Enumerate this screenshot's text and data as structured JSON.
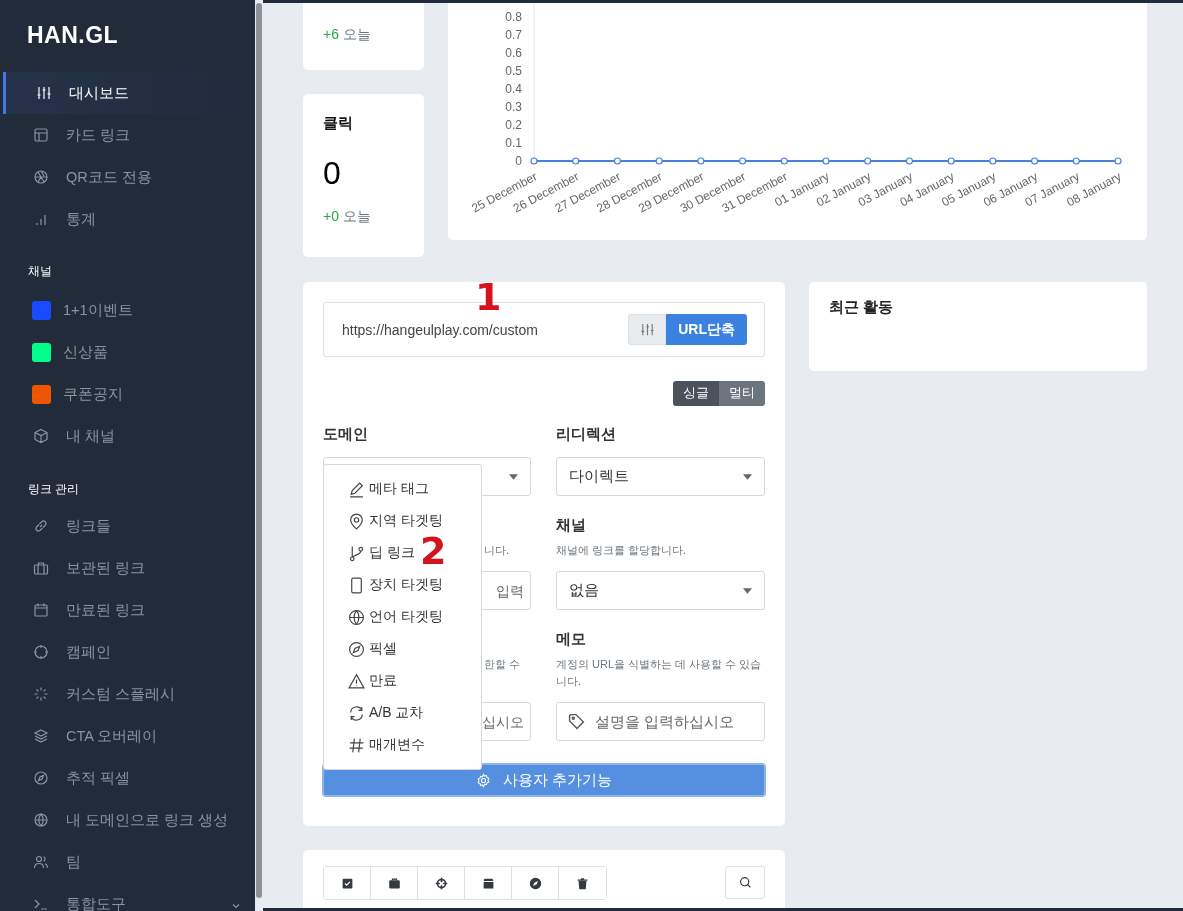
{
  "sidebar": {
    "logo": "HAN.GL",
    "nav": [
      {
        "label": "대시보드",
        "selected": true
      },
      {
        "label": "카드 링크",
        "selected": false
      },
      {
        "label": "QR코드 전용",
        "selected": false
      },
      {
        "label": "통계",
        "selected": false
      }
    ],
    "channels": {
      "heading": "채널",
      "items": [
        {
          "label": "1+1이벤트",
          "kind": "color",
          "color": "#1a4cff",
          "selected": false
        },
        {
          "label": "신상품",
          "kind": "color",
          "color": "#00ff88",
          "selected": false
        },
        {
          "label": "쿠폰공지",
          "kind": "color",
          "color": "#ee5500",
          "selected": false
        },
        {
          "label": "내 채널",
          "kind": "icon",
          "selected": false
        }
      ]
    },
    "links": {
      "heading": "링크 관리",
      "items": [
        {
          "label": "링크들",
          "kind": "link",
          "selected": false
        },
        {
          "label": "보관된 링크",
          "kind": "link",
          "selected": false
        },
        {
          "label": "만료된 링크",
          "kind": "link",
          "selected": false
        },
        {
          "label": "캠페인",
          "kind": "link",
          "selected": false
        },
        {
          "label": "커스텀 스플레시",
          "kind": "link",
          "selected": false
        },
        {
          "label": "CTA 오버레이",
          "kind": "link",
          "selected": false
        },
        {
          "label": "추적 픽셀",
          "kind": "link",
          "selected": false
        },
        {
          "label": "내 도메인으로 링크 생성",
          "kind": "link",
          "selected": false
        },
        {
          "label": "팀",
          "kind": "link",
          "selected": false
        },
        {
          "label": "통합도구",
          "kind": "group",
          "selected": false
        }
      ]
    }
  },
  "stats": [
    {
      "delta": "+6",
      "delta_label": "오늘"
    },
    {
      "title": "클릭",
      "value": "0",
      "delta": "+0",
      "delta_label": "오늘"
    }
  ],
  "chart": {
    "chart_data": {
      "type": "line",
      "categories": [
        "25 December",
        "26 December",
        "27 December",
        "28 December",
        "29 December",
        "30 December",
        "31 December",
        "01 January",
        "02 January",
        "03 January",
        "04 January",
        "05 January",
        "06 January",
        "07 January",
        "08 January"
      ],
      "series": [
        {
          "color": "#4a80dc",
          "marker": true,
          "values": [
            0,
            0,
            0,
            0,
            0,
            0,
            0,
            0,
            0,
            0,
            0,
            0,
            0,
            0,
            0
          ]
        }
      ],
      "ylim": [
        0,
        0.9
      ],
      "yticks": [
        0,
        0.1,
        0.2,
        0.3,
        0.4,
        0.5,
        0.6,
        0.7,
        0.8
      ]
    }
  },
  "form": {
    "url_value": "https://hangeulplay.com/custom",
    "shorten_button": "URL단축",
    "mode_toggle": [
      {
        "label": "싱글",
        "selected": true
      },
      {
        "label": "멀티",
        "selected": false
      }
    ],
    "fields": [
      {
        "kind": "select",
        "label": "도메인"
      },
      {
        "kind": "select",
        "label": "리디렉션",
        "value": "다이렉트"
      },
      {
        "kind": "input",
        "description": "니다.",
        "placeholder": "입력",
        "covered": true
      },
      {
        "kind": "select",
        "label": "채널",
        "description": "채널에 링크를 할당합니다.",
        "value": "없음"
      },
      {
        "kind": "input",
        "description": "한할 수",
        "placeholder": "십시오",
        "covered": true
      },
      {
        "kind": "tag-input",
        "label": "메모",
        "description": "계정의 URL을 식별하는 데 사용할 수 있습니다.",
        "placeholder": "설명을 입력하십시오",
        "covered": false
      }
    ],
    "menu": [
      {
        "label": "메타 태그"
      },
      {
        "label": "지역 타겟팅"
      },
      {
        "label": "딥 링크"
      },
      {
        "label": "장치 타겟팅"
      },
      {
        "label": "언어 타겟팅"
      },
      {
        "label": "픽셀"
      },
      {
        "label": "만료"
      },
      {
        "label": "A/B 교차"
      },
      {
        "label": "매개변수"
      }
    ],
    "submit_button": "사용자 추가기능"
  },
  "recent_activity": {
    "title": "최근 활동"
  },
  "annotations": [
    {
      "label": "1"
    },
    {
      "label": "2"
    }
  ]
}
